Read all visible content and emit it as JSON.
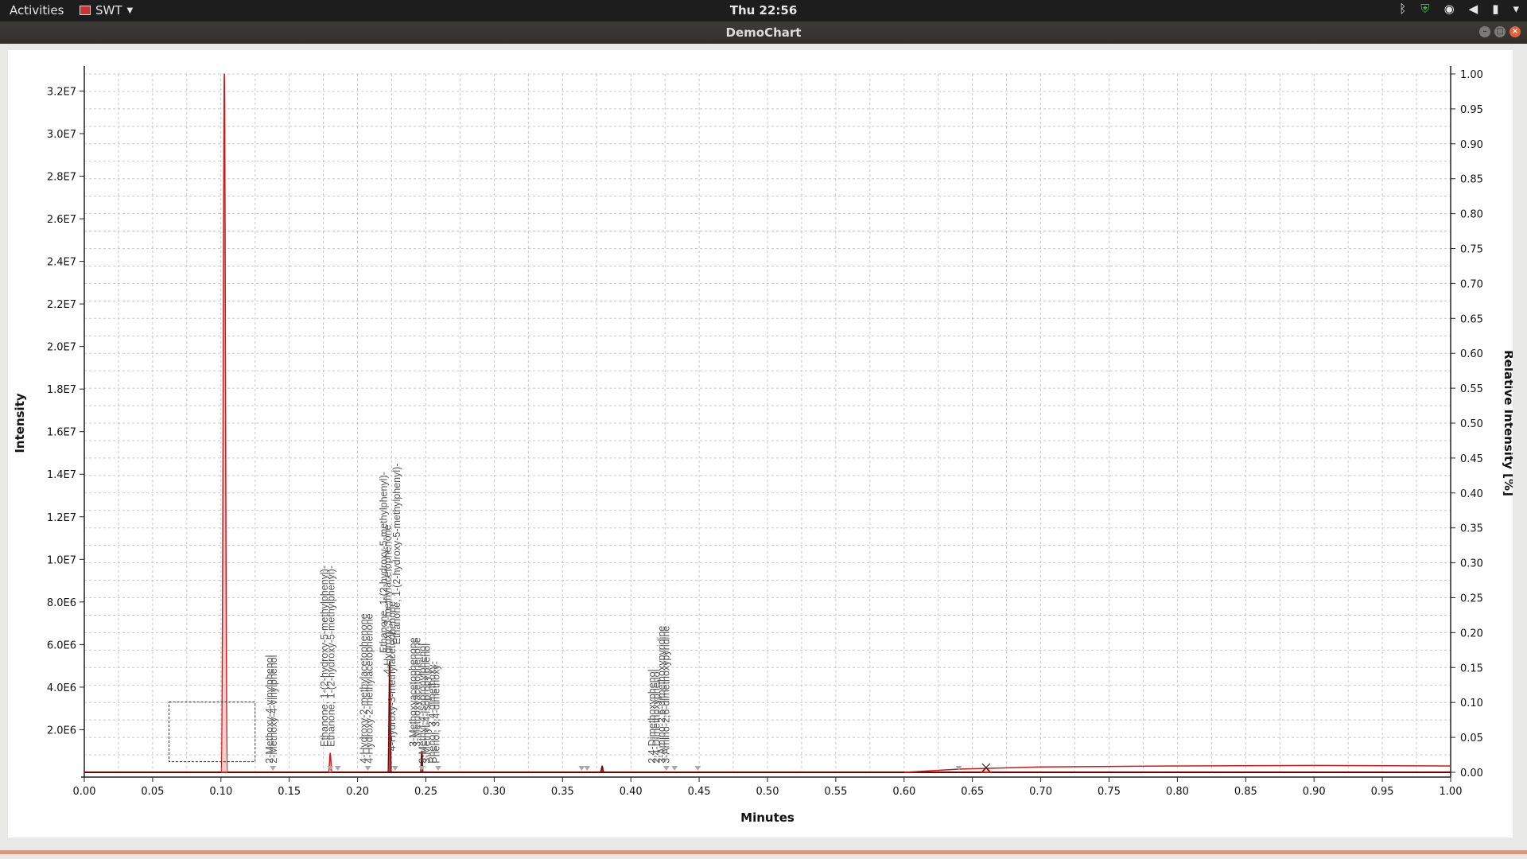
{
  "topbar": {
    "activities": "Activities",
    "app_name": "SWT",
    "clock": "Thu 22:56",
    "tray_icons": [
      "bluetooth-icon",
      "shield-icon",
      "wifi-icon",
      "volume-icon",
      "battery-icon",
      "power-icon"
    ]
  },
  "window": {
    "title": "DemoChart"
  },
  "colors": {
    "trace": "#cc1a1a",
    "trace_fill": "#f2b8b8",
    "dark_trace": "#7a0000",
    "grid": "#c8c8c8",
    "marker": "#aaaaaa"
  },
  "chart_data": {
    "type": "line",
    "xlabel": "Minutes",
    "ylabel": "Intensity",
    "y2label": "Relative Intensity [%]",
    "xlim": [
      0.0,
      1.0
    ],
    "ylim": [
      0,
      32800000
    ],
    "y2lim": [
      0.0,
      1.0
    ],
    "grid": true,
    "xticks": [
      "0.00",
      "0.05",
      "0.10",
      "0.15",
      "0.20",
      "0.25",
      "0.30",
      "0.35",
      "0.40",
      "0.45",
      "0.50",
      "0.55",
      "0.60",
      "0.65",
      "0.70",
      "0.75",
      "0.80",
      "0.85",
      "0.90",
      "0.95",
      "1.00"
    ],
    "yticks": [
      {
        "v": 2000000,
        "label": "2.0E6"
      },
      {
        "v": 4000000,
        "label": "4.0E6"
      },
      {
        "v": 6000000,
        "label": "6.0E6"
      },
      {
        "v": 8000000,
        "label": "8.0E6"
      },
      {
        "v": 10000000,
        "label": "1.0E7"
      },
      {
        "v": 12000000,
        "label": "1.2E7"
      },
      {
        "v": 14000000,
        "label": "1.4E7"
      },
      {
        "v": 16000000,
        "label": "1.6E7"
      },
      {
        "v": 18000000,
        "label": "1.8E7"
      },
      {
        "v": 20000000,
        "label": "2.0E7"
      },
      {
        "v": 22000000,
        "label": "2.2E7"
      },
      {
        "v": 24000000,
        "label": "2.4E7"
      },
      {
        "v": 26000000,
        "label": "2.6E7"
      },
      {
        "v": 28000000,
        "label": "2.8E7"
      },
      {
        "v": 30000000,
        "label": "3.0E7"
      },
      {
        "v": 32000000,
        "label": "3.2E7"
      }
    ],
    "y2ticks": [
      "0.00",
      "0.05",
      "0.10",
      "0.15",
      "0.20",
      "0.25",
      "0.30",
      "0.35",
      "0.40",
      "0.45",
      "0.50",
      "0.55",
      "0.60",
      "0.65",
      "0.70",
      "0.75",
      "0.80",
      "0.85",
      "0.90",
      "0.95",
      "1.00"
    ],
    "peaks": [
      {
        "x": 0.1025,
        "y": 32800000,
        "w": 0.0025,
        "color": "red"
      },
      {
        "x": 0.18,
        "y": 900000,
        "w": 0.0015,
        "color": "red"
      },
      {
        "x": 0.2235,
        "y": 5200000,
        "w": 0.0015,
        "color": "dark"
      },
      {
        "x": 0.247,
        "y": 1000000,
        "w": 0.0012,
        "color": "dark"
      },
      {
        "x": 0.379,
        "y": 300000,
        "w": 0.0015,
        "color": "dark"
      },
      {
        "x": 0.66,
        "y": 200000,
        "w": 0.004,
        "color": "red"
      }
    ],
    "drift": [
      {
        "x": 0.6,
        "y": 0
      },
      {
        "x": 0.64,
        "y": 150000
      },
      {
        "x": 0.7,
        "y": 250000
      },
      {
        "x": 0.8,
        "y": 300000
      },
      {
        "x": 0.9,
        "y": 320000
      },
      {
        "x": 1.0,
        "y": 300000
      }
    ],
    "labels": [
      {
        "x": 0.138,
        "y": 420000,
        "text": "2-Methoxy-4-vinylphenol"
      },
      {
        "x": 0.141,
        "y": 420000,
        "text": "2-Methoxy-4-vinylphenol"
      },
      {
        "x": 0.178,
        "y": 1200000,
        "text": "Ethanone, 1-(2-hydroxy-5-methylphenyl)-"
      },
      {
        "x": 0.183,
        "y": 1200000,
        "text": "Ethanone, 1-(2-hydroxy-5-methylphenyl)-"
      },
      {
        "x": 0.207,
        "y": 420000,
        "text": "4-Hydroxy-2-methylacetophenone"
      },
      {
        "x": 0.211,
        "y": 420000,
        "text": "4-Hydroxy-2-methylacetophenone"
      },
      {
        "x": 0.2215,
        "y": 5600000,
        "text": "Ethanone, 1-(2-hydroxy-5-methylphenyl)-"
      },
      {
        "x": 0.2245,
        "y": 4600000,
        "text": "4-Hydroxy-3-methylacetophenone"
      },
      {
        "x": 0.2275,
        "y": 1000000,
        "text": "4-Hydroxy-3-methylacetophenone"
      },
      {
        "x": 0.231,
        "y": 6000000,
        "text": "Ethanone, 1-(2-hydroxy-5-methylphenyl)-"
      },
      {
        "x": 0.243,
        "y": 1200000,
        "text": "3-Methoxyacetophenone"
      },
      {
        "x": 0.246,
        "y": 1200000,
        "text": "3-Methoxyacetophenone"
      },
      {
        "x": 0.25,
        "y": 420000,
        "text": "3-Methyl-4-isopropylphenol"
      },
      {
        "x": 0.253,
        "y": 420000,
        "text": "3-Methyl-4-isopropylphenol"
      },
      {
        "x": 0.257,
        "y": 420000,
        "text": "Phenol, 3,4-dimethoxy-"
      },
      {
        "x": 0.26,
        "y": 420000,
        "text": "Phenol, 3,4-dimethoxy-"
      },
      {
        "x": 0.418,
        "y": 420000,
        "text": "2,4-Dimethoxyphenol"
      },
      {
        "x": 0.421,
        "y": 420000,
        "text": "2,4-Dimethoxyphenol"
      },
      {
        "x": 0.425,
        "y": 420000,
        "text": "3-Amino-2,6-dimethoxypyridine"
      },
      {
        "x": 0.428,
        "y": 420000,
        "text": "3-Amino-2,6-dimethoxypyridine"
      }
    ],
    "markers": [
      0.138,
      0.18,
      0.1855,
      0.2075,
      0.2275,
      0.247,
      0.259,
      0.364,
      0.368,
      0.426,
      0.432,
      0.449,
      0.64
    ],
    "x_marker": 0.66,
    "selection": {
      "x0": 0.062,
      "x1": 0.125,
      "y0": 500000,
      "y1": 3300000
    }
  }
}
